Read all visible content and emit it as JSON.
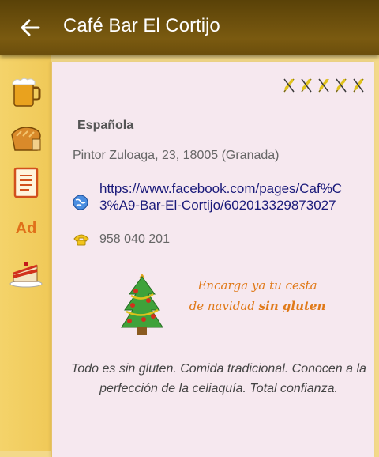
{
  "header": {
    "title": "Café Bar El Cortijo",
    "back_icon": "arrow-left-icon"
  },
  "sidebar": {
    "items": [
      {
        "icon": "beer-mug-icon"
      },
      {
        "icon": "bread-icon"
      },
      {
        "icon": "menu-list-icon"
      },
      {
        "icon": "ad-icon",
        "label": "Ad"
      },
      {
        "icon": "cake-icon"
      }
    ]
  },
  "restaurant": {
    "rating_count": 5,
    "rating_icon": "wheat-crossed-icon",
    "cuisine": "Española",
    "address": "Pintor Zuloaga, 23, 18005  (Granada)",
    "website": "https://www.facebook.com/pages/Caf%C3%A9-Bar-El-Cortijo/602013329873027",
    "phone": "958 040 201",
    "promo": {
      "line1": "Encarga ya tu cesta",
      "line2_a": "de navidad",
      "line2_b": "sin gluten"
    },
    "description": "Todo es sin gluten. Comida tradicional. Conocen a la perfección de la celiaquía. Total confianza."
  },
  "colors": {
    "appbar": "#6b4e0c",
    "sidebar": "#f0c958",
    "card": "#f6e8ef",
    "link": "#1a1a7a",
    "promo": "#e07a1a"
  }
}
